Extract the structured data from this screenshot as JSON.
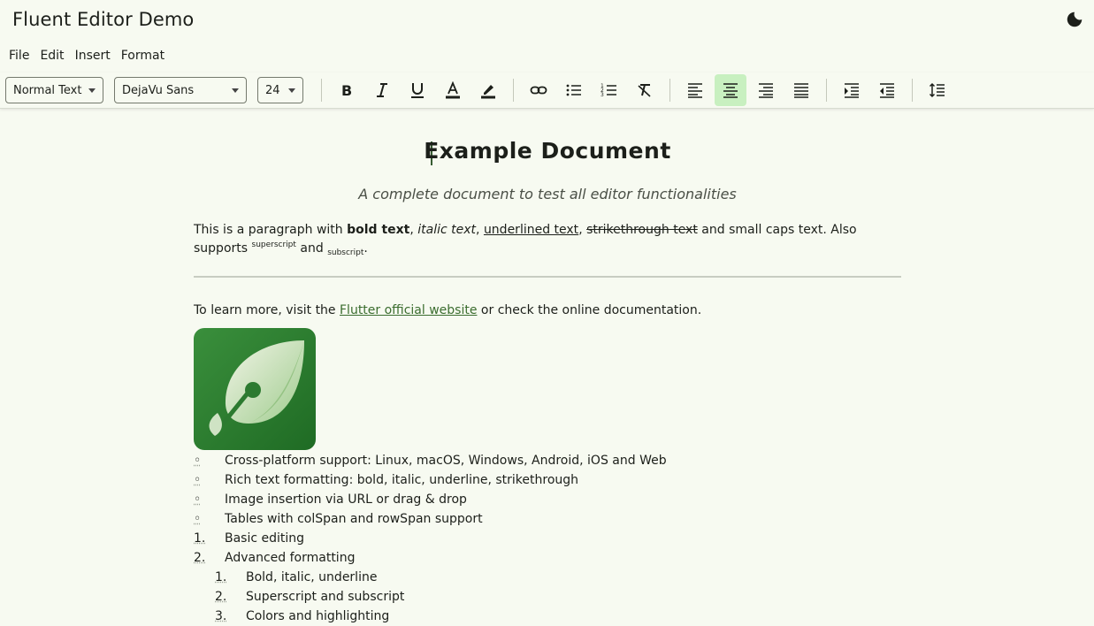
{
  "app": {
    "title": "Fluent Editor Demo",
    "theme_icon": "dark-mode-moon-icon"
  },
  "menu": [
    "File",
    "Edit",
    "Insert",
    "Format"
  ],
  "toolbar": {
    "paragraph_style": "Normal Text",
    "font_family": "DejaVu Sans",
    "font_size": "24",
    "active_alignment": "center",
    "buttons": [
      "bold",
      "italic",
      "underline",
      "text-color",
      "highlight",
      "link",
      "bullet-list",
      "numbered-list",
      "clear-format",
      "align-left",
      "align-center",
      "align-right",
      "align-justify",
      "indent",
      "outdent",
      "line-spacing"
    ]
  },
  "document": {
    "title": "Example Document",
    "subtitle": "A complete document to test all editor functionalities",
    "paragraph": {
      "t1": "This is a paragraph with ",
      "bold": "bold text",
      "t2": ", ",
      "italic": "italic text",
      "t3": ", ",
      "underline": "underlined text",
      "t4": ", ",
      "strike": "strikethrough text",
      "t5": " and small caps text. Also supports ",
      "sup": "superscript",
      "t6": " and ",
      "sub": "subscript",
      "t7": "."
    },
    "link_paragraph": {
      "before": "To learn more, visit the ",
      "link": "Flutter official website",
      "after": " or check the online documentation."
    },
    "image_icon": "leaf-logo-icon",
    "bullets": [
      "Cross-platform support: Linux, macOS, Windows, Android, iOS and Web",
      "Rich text formatting: bold, italic, underline, strikethrough",
      "Image insertion via URL or drag & drop",
      "Tables with colSpan and rowSpan support"
    ],
    "bullet_marker": "◦",
    "numbered": [
      {
        "marker": "1.",
        "text": "Basic editing"
      },
      {
        "marker": "2.",
        "text": "Advanced formatting"
      }
    ],
    "sub_numbered": [
      {
        "marker": "1.",
        "text": "Bold, italic, underline"
      },
      {
        "marker": "2.",
        "text": "Superscript and subscript"
      },
      {
        "marker": "3.",
        "text": "Colors and highlighting"
      }
    ]
  },
  "colors": {
    "background": "#f7faf1",
    "active_button": "#c8f0c0",
    "link": "#3b6d2f",
    "logo_green": "#2e7d32"
  }
}
